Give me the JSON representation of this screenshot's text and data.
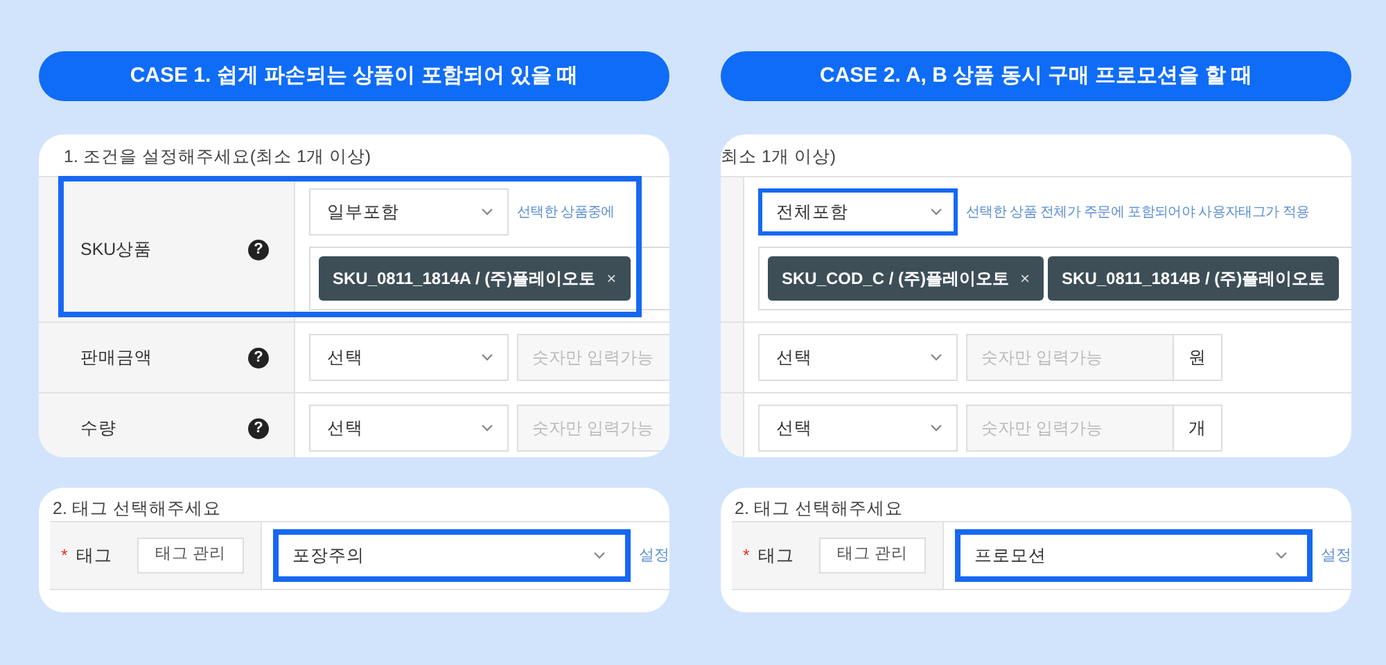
{
  "cases": [
    {
      "title": "CASE 1. 쉽게 파손되는 상품이 포함되어 있을 때",
      "conditions": {
        "heading": "1. 조건을 설정해주세요(최소 1개 이상)",
        "label_column": true,
        "rows": [
          {
            "kind": "product",
            "label": "SKU상품",
            "help": "?",
            "select": "일부포함",
            "hint": "선택한 상품중에",
            "row_highlighted": true,
            "chips": [
              {
                "text": "SKU_0811_1814A / (주)플레이오토",
                "remove": "×"
              }
            ]
          },
          {
            "kind": "number",
            "label": "판매금액",
            "help": "?",
            "select": "선택",
            "placeholder": "숫자만 입력가능"
          },
          {
            "kind": "number",
            "label": "수량",
            "help": "?",
            "select": "선택",
            "placeholder": "숫자만 입력가능"
          }
        ]
      },
      "tag_section": {
        "heading": "2. 태그 선택해주세요",
        "required_mark": "*",
        "label": "태그",
        "manage_button": "태그 관리",
        "select": "포장주의",
        "highlighted": true,
        "link": "설정"
      }
    },
    {
      "title": "CASE 2. A, B 상품 동시 구매 프로모션을 할 때",
      "conditions": {
        "heading": "최소 1개 이상)",
        "label_column": false,
        "rows": [
          {
            "kind": "product",
            "select": "전체포함",
            "hint": "선택한 상품 전체가 주문에 포함되어야 사용자태그가 적용",
            "select_highlighted": true,
            "chips": [
              {
                "text": "SKU_COD_C / (주)플레이오토",
                "remove": "×"
              },
              {
                "text": "SKU_0811_1814B / (주)플레이오토"
              }
            ]
          },
          {
            "kind": "number",
            "select": "선택",
            "placeholder": "숫자만 입력가능",
            "unit": "원"
          },
          {
            "kind": "number",
            "select": "선택",
            "placeholder": "숫자만 입력가능",
            "unit": "개"
          }
        ]
      },
      "tag_section": {
        "heading": "2. 태그 선택해주세요",
        "required_mark": "*",
        "label": "태그",
        "manage_button": "태그 관리",
        "select": "프로모션",
        "highlighted": true,
        "link": "설정"
      }
    }
  ]
}
